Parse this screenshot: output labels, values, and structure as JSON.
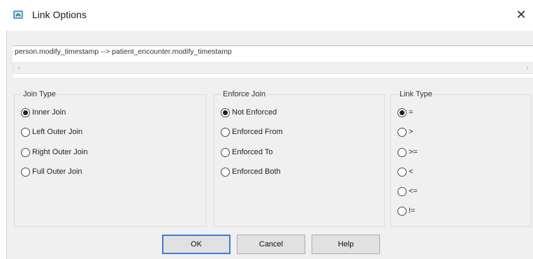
{
  "window": {
    "title": "Link Options",
    "close_glyph": "✕",
    "app_icon": "link-options-icon"
  },
  "link_expression": "person.modify_timestamp --> patient_encounter.modify_timestamp",
  "scrollbar": {
    "left_arrow": "‹",
    "right_arrow": "›"
  },
  "join_type": {
    "title": "Join Type",
    "selected": "Inner Join",
    "options": [
      "Inner Join",
      "Left Outer Join",
      "Right Outer Join",
      "Full Outer Join"
    ]
  },
  "enforce_join": {
    "title": "Enforce Join",
    "selected": "Not Enforced",
    "options": [
      "Not Enforced",
      "Enforced From",
      "Enforced To",
      "Enforced Both"
    ]
  },
  "link_type": {
    "title": "Link Type",
    "selected": "=",
    "options": [
      "=",
      ">",
      ">=",
      "<",
      "<=",
      "!="
    ]
  },
  "buttons": {
    "ok": "OK",
    "cancel": "Cancel",
    "help": "Help"
  },
  "colors": {
    "accent": "#3d7bd9",
    "dialog_bg": "#f0f0f0"
  }
}
